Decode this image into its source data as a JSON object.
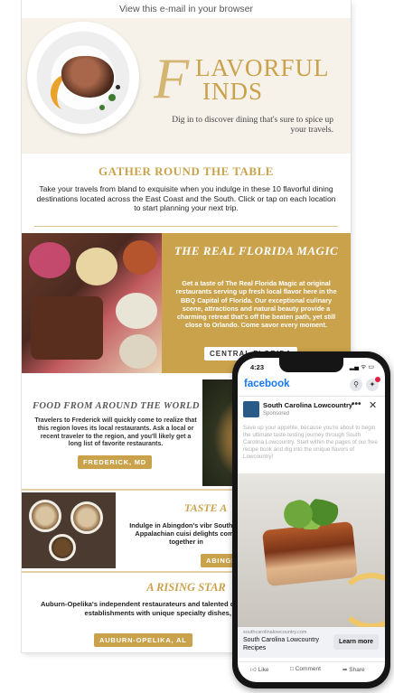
{
  "email": {
    "browser_link": "View this e-mail in your browser",
    "hero": {
      "title_initial": "F",
      "title_line1": "LAVORFUL",
      "title_line2": "INDS",
      "subtitle": "Dig in to discover dining that's sure to spice up your travels."
    },
    "gather": {
      "heading": "GATHER ROUND THE TABLE",
      "intro": "Take your travels from bland to exquisite when you indulge in these 10 flavorful dining destinations located across the East Coast and the South. Click or tap on each location to start planning your next trip."
    },
    "florida": {
      "title": "THE REAL FLORIDA MAGIC",
      "body": "Get a taste of The Real Florida Magic at original restaurants serving up fresh local flavor here in the BBQ Capital of Florida. Our exceptional culinary scene, attractions and natural beauty provide a charming retreat that's off the beaten path, yet still close to Orlando. Come savor every moment.",
      "button": "CENTRAL FLORIDA"
    },
    "frederick": {
      "title": "FOOD FROM AROUND THE WORLD",
      "body": "Travelers to Frederick will quickly come to realize that this region loves its local restaurants. Ask a local or recent traveler to the region, and you'll likely get a long list of favorite restaurants.",
      "button": "FREDERICK, MD"
    },
    "abingdon": {
      "title": "TASTE A",
      "body": "Indulge in Abingdon's vibr Southern Appalachian cuisi delights come together in",
      "button": "ABINGD"
    },
    "auburn": {
      "title": "A RISING STAR",
      "body": "Auburn-Opelika's independent restaurateurs and talented chefs have created exceptional establishments with unique specialty dishes, such as Botanic.",
      "button": "AUBURN-OPELIKA, AL"
    }
  },
  "phone": {
    "time": "4:23",
    "status_icons": "▂▄ ᯤ ▭",
    "app_name": "facebook",
    "post": {
      "page_name": "South Carolina Lowcountry",
      "sponsored": "Sponsored",
      "more": "•••",
      "close": "✕",
      "text": "Save up your appetite, because you're about to begin the ultimate taste-testing journey through South Carolina Lowcountry. Start within the pages of our free recipe book and dig into the unique flavors of Lowcountry!",
      "link_url": "southcarolinalowcountry.com",
      "link_title": "South Carolina Lowcountry Recipes",
      "cta": "Learn more"
    },
    "actions": {
      "like": "Like",
      "comment": "Comment",
      "share": "Share"
    }
  },
  "colors": {
    "gold": "#c9a24b",
    "facebook_blue": "#1877f2"
  }
}
